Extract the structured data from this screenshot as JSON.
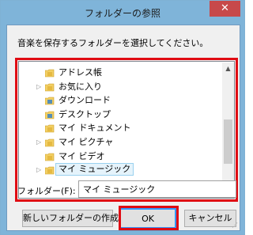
{
  "window": {
    "title": "フォルダーの参照",
    "close_glyph": "✕"
  },
  "instruction": "音楽を保存するフォルダーを選択してください。",
  "tree": {
    "items": [
      {
        "label": "アドレス帳",
        "expandable": false,
        "icon": "folder-contacts-icon"
      },
      {
        "label": "お気に入り",
        "expandable": true,
        "icon": "folder-favorites-icon"
      },
      {
        "label": "ダウンロード",
        "expandable": false,
        "icon": "folder-download-icon"
      },
      {
        "label": "デスクトップ",
        "expandable": false,
        "icon": "folder-desktop-icon"
      },
      {
        "label": "マイ ドキュメント",
        "expandable": false,
        "icon": "folder-documents-icon"
      },
      {
        "label": "マイ ピクチャ",
        "expandable": true,
        "icon": "folder-pictures-icon"
      },
      {
        "label": "マイ ビデオ",
        "expandable": false,
        "icon": "folder-videos-icon"
      },
      {
        "label": "マイ ミュージック",
        "expandable": true,
        "icon": "folder-music-icon",
        "selected": true
      }
    ]
  },
  "folder_field": {
    "label": "フォルダー(F):",
    "value": "マイ ミュージック"
  },
  "buttons": {
    "new_folder": "新しいフォルダーの作成(N)",
    "ok": "OK",
    "cancel": "キャンセル"
  },
  "colors": {
    "highlight": "#e00b13",
    "accent": "#3399ff",
    "close": "#c7494a"
  }
}
